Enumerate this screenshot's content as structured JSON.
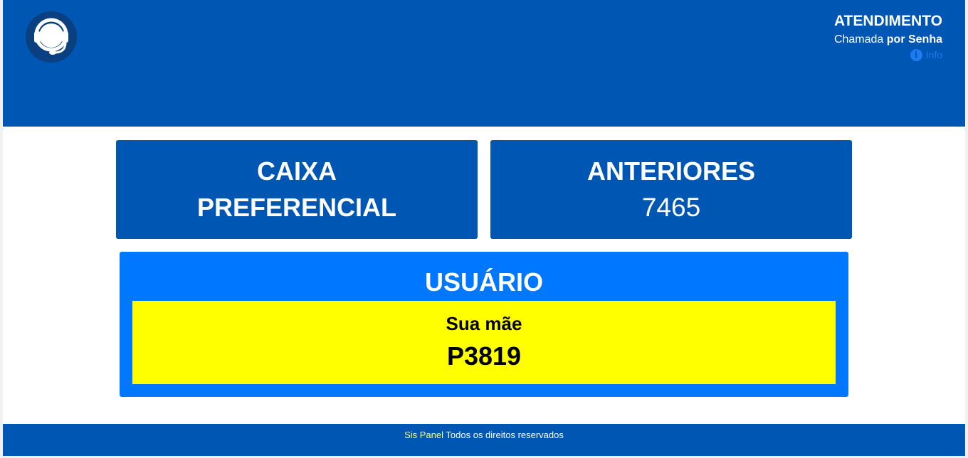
{
  "header": {
    "title": "ATENDIMENTO",
    "subtitle_prefix": "Chamada",
    "subtitle_bold": "por Senha",
    "info_label": "Info",
    "info_glyph": "i",
    "logo_icon": "headset-icon"
  },
  "cards": {
    "caixa": {
      "line1": "CAIXA",
      "line2": "PREFERENCIAL"
    },
    "anteriores": {
      "title": "ANTERIORES",
      "value": "7465"
    }
  },
  "user": {
    "title": "USUÁRIO",
    "name": "Sua mãe",
    "code": "P3819"
  },
  "footer": {
    "brand": "Sis Panel",
    "text": "Todos os direitos reservados"
  },
  "colors": {
    "primary": "#0056b3",
    "accent": "#0077ff",
    "highlight": "#ffff00",
    "brand_text": "#ffff66"
  }
}
